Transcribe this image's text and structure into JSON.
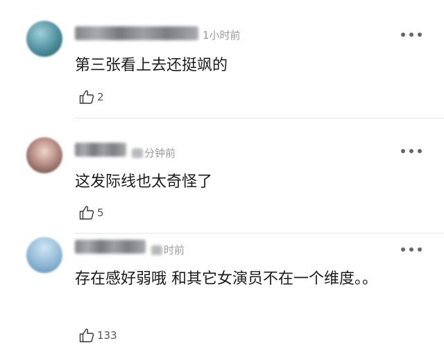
{
  "comments": [
    {
      "time": "1小时前",
      "text": "第三张看上去还挺飒的",
      "likes": "2",
      "avatar_icon": "avatar-icon",
      "more_icon": "more-dots-icon",
      "like_icon": "thumbs-up-icon"
    },
    {
      "time": "分钟前",
      "text": "这发际线也太奇怪了",
      "likes": "5",
      "avatar_icon": "avatar-icon",
      "more_icon": "more-dots-icon",
      "like_icon": "thumbs-up-icon"
    },
    {
      "time": "时前",
      "text": "存在感好弱哦 和其它女演员不在一个维度。。",
      "likes": "133",
      "avatar_icon": "avatar-icon",
      "more_icon": "more-dots-icon",
      "like_icon": "thumbs-up-icon"
    }
  ]
}
